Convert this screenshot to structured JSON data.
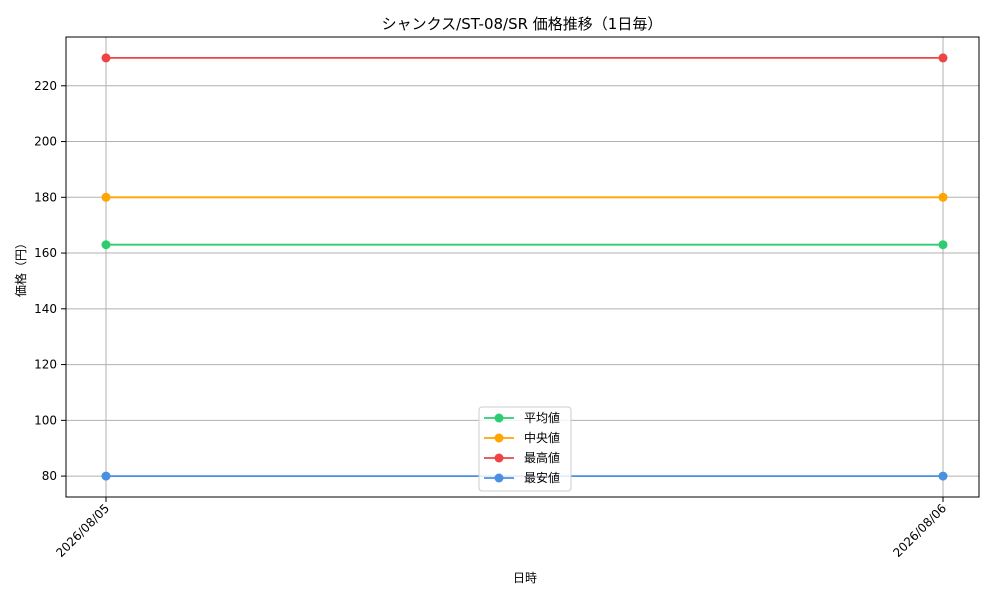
{
  "chart_data": {
    "type": "line",
    "title": "シャンクス/ST-08/SR 価格推移（1日毎）",
    "xlabel": "日時",
    "ylabel": "価格（円）",
    "x": [
      "2026/08/05",
      "2026/08/06"
    ],
    "ylim": [
      72.5,
      237.5
    ],
    "yticks": [
      80,
      100,
      120,
      140,
      160,
      180,
      200,
      220
    ],
    "grid": true,
    "legend_position": "lower-center",
    "series": [
      {
        "name": "平均値",
        "color": "#2ecc71",
        "values": [
          163,
          163
        ]
      },
      {
        "name": "中央値",
        "color": "#ffa500",
        "values": [
          180,
          180
        ]
      },
      {
        "name": "最高値",
        "color": "#ef4444",
        "values": [
          230,
          230
        ]
      },
      {
        "name": "最安値",
        "color": "#4a90e2",
        "values": [
          80,
          80
        ]
      }
    ]
  }
}
